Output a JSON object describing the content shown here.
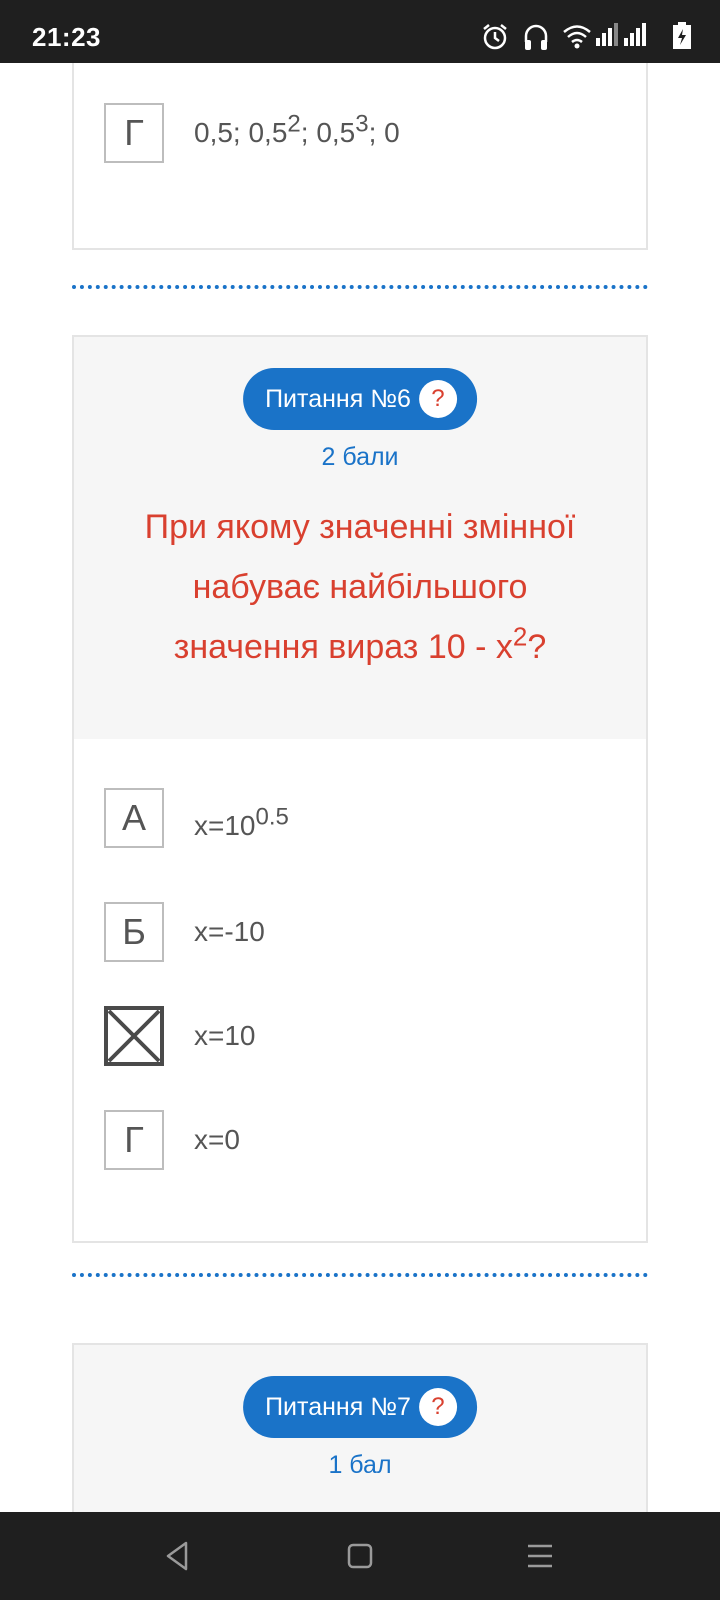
{
  "status": {
    "time": "21:23",
    "icons": [
      "alarm-icon",
      "headphones-icon",
      "wifi-icon",
      "signal-icon",
      "signal-icon",
      "battery-charging-icon"
    ]
  },
  "previous_question": {
    "option": {
      "letter": "Г",
      "parts": [
        "0,5; 0,5",
        "2",
        "; 0,5",
        "3",
        "; 0"
      ]
    }
  },
  "question6": {
    "label": "Питання №6",
    "help": "?",
    "points": "2 бали",
    "text_line1": "При якому значенні змінної",
    "text_line2": "набуває найбільшого",
    "text_line3": "значення вираз 10 - x",
    "text_sup": "2",
    "text_end": "?",
    "options": [
      {
        "letter": "А",
        "text": "x=10",
        "sup": "0.5",
        "checked": false
      },
      {
        "letter": "Б",
        "text": "x=-10",
        "sup": "",
        "checked": false
      },
      {
        "letter": "",
        "text": "x=10",
        "sup": "",
        "checked": true
      },
      {
        "letter": "Г",
        "text": "x=0",
        "sup": "",
        "checked": false
      }
    ]
  },
  "question7": {
    "label": "Питання №7",
    "help": "?",
    "points": "1 бал"
  },
  "nav": {
    "icons": [
      "back-icon",
      "home-icon",
      "menu-icon"
    ]
  },
  "colors": {
    "accent": "#1a73c8",
    "question_text": "#d9402f",
    "status_bar": "#1f1f1f"
  }
}
